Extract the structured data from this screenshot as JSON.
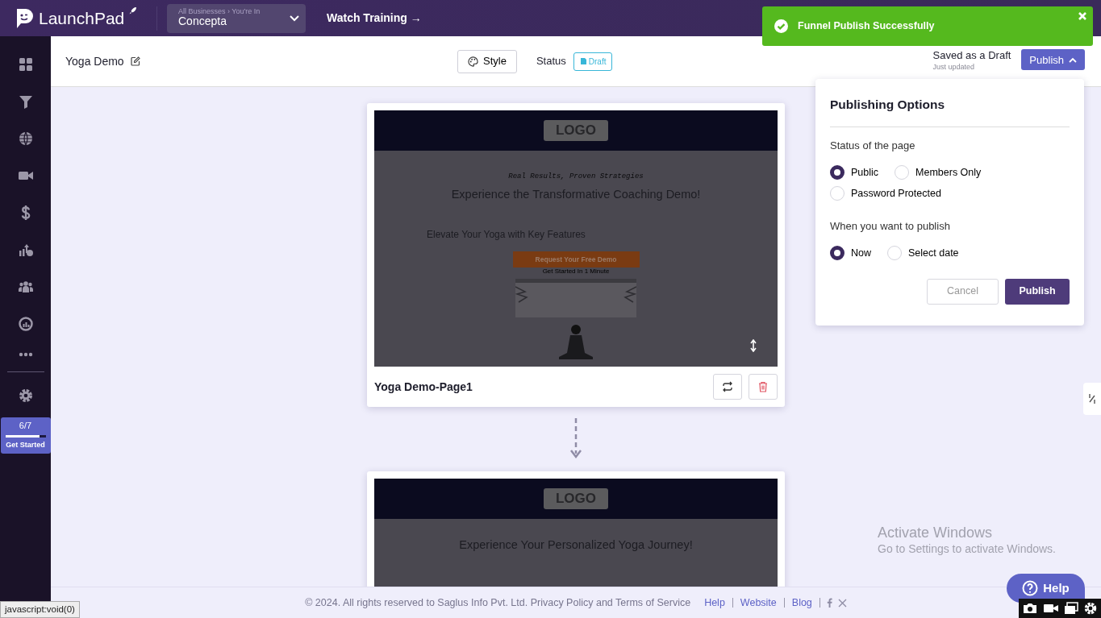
{
  "brand": {
    "name": "LaunchPad"
  },
  "business_switcher": {
    "breadcrumb": "All Businesses › You're In",
    "value": "Concepta"
  },
  "watch_training": "Watch Training →",
  "toast": {
    "message": "Funnel Publish Successfully"
  },
  "progress": {
    "count": "6/7",
    "level": 0.857,
    "label": "Get Started"
  },
  "header": {
    "title": "Yoga Demo",
    "style_button": "Style",
    "status_label": "Status",
    "status_badge": "Draft",
    "saved_text": "Saved as a Draft",
    "saved_sub": "Just updated",
    "publish_button": "Publish",
    "publish_expanded": true
  },
  "publishing_options": {
    "title": "Publishing Options",
    "groups": [
      {
        "label": "Status of the page",
        "options": [
          {
            "label": "Public",
            "selected": true
          },
          {
            "label": "Members Only",
            "selected": false
          },
          {
            "label": "Password Protected",
            "selected": false
          }
        ]
      },
      {
        "label": "When you want to publish",
        "options": [
          {
            "label": "Now",
            "selected": true
          },
          {
            "label": "Select date",
            "selected": false
          }
        ]
      }
    ],
    "buttons": [
      {
        "label": "Cancel",
        "kind": "secondary"
      },
      {
        "label": "Publish",
        "kind": "primary"
      }
    ]
  },
  "pages": [
    {
      "name": "Yoga Demo-Page1",
      "preview": {
        "logo": "LOGO",
        "tagline": "Real Results, Proven Strategies",
        "headline": "Experience the Transformative Coaching Demo!",
        "subheading": "Elevate Your Yoga with Key Features",
        "cta": "Request Your Free Demo",
        "cta_note": "Get Started In 1 Minute"
      }
    },
    {
      "preview": {
        "logo": "LOGO",
        "headline": "Experience Your Personalized Yoga Journey!"
      }
    }
  ],
  "footer": {
    "legal": "©  2024. All rights reserved to Saglus Info Pvt. Ltd.",
    "privacy": "Privacy Policy",
    "conjunction": "and",
    "terms": "Terms of Service",
    "links": [
      "Help",
      "Website",
      "Blog"
    ]
  },
  "status_tooltip": "javascript:void(0)",
  "help_button": "Help",
  "os_notice": {
    "title": "Activate Windows",
    "text": "Go to Settings to activate Windows."
  }
}
